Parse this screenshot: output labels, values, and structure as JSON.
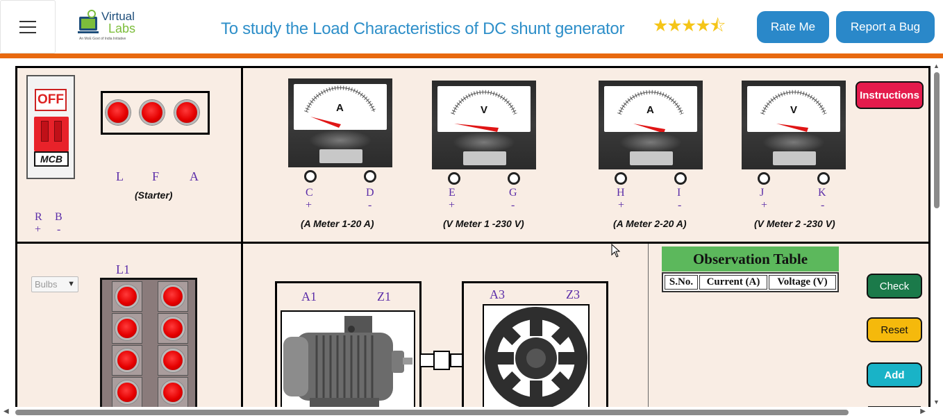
{
  "header": {
    "menu_icon": "hamburger-icon",
    "logo": {
      "line1": "Virtual",
      "line2": "Labs",
      "tagline": "An MoE Govt of India Initiative"
    },
    "title": "To study the Load Characteristics of DC shunt generator",
    "rating": {
      "value": 4.5,
      "max": 5,
      "stars": "★★★★",
      "half_star": "⯪"
    },
    "rate_button": "Rate Me",
    "bug_button": "Report a Bug"
  },
  "colors": {
    "accent_blue": "#2a88c9",
    "header_orange": "#e8690f",
    "sim_bg": "#f9ede4",
    "instructions_red": "#e41b4c",
    "check_green": "#1b7a4a",
    "reset_yellow": "#f5b90c",
    "add_teal": "#19b3c7",
    "table_green": "#5cb85c"
  },
  "mcb": {
    "state_label": "OFF",
    "name": "MCB"
  },
  "starter": {
    "terminals": [
      "L",
      "F",
      "A"
    ],
    "caption": "(Starter)"
  },
  "supply": {
    "terminals": [
      "R",
      "B"
    ],
    "polarities": [
      "+",
      "-"
    ]
  },
  "meters": [
    {
      "symbol": "A",
      "terminals": [
        "C",
        "D"
      ],
      "polarities": [
        "+",
        "-"
      ],
      "caption": "(A Meter 1-20 A)"
    },
    {
      "symbol": "V",
      "terminals": [
        "E",
        "G"
      ],
      "polarities": [
        "+",
        "-"
      ],
      "caption": "(V Meter 1 -230 V)"
    },
    {
      "symbol": "A",
      "terminals": [
        "H",
        "I"
      ],
      "polarities": [
        "+",
        "-"
      ],
      "caption": "(A Meter 2-20 A)"
    },
    {
      "symbol": "V",
      "terminals": [
        "J",
        "K"
      ],
      "polarities": [
        "+",
        "-"
      ],
      "caption": "(V Meter 2 -230 V)"
    }
  ],
  "instructions_button": "Instructions",
  "load": {
    "select_value": "Bulbs",
    "label": "L1",
    "bulb_count": 8
  },
  "motor": {
    "terminals": [
      "A1",
      "Z1"
    ]
  },
  "generator": {
    "terminals": [
      "A3",
      "Z3"
    ]
  },
  "observation": {
    "title": "Observation Table",
    "columns": [
      "S.No.",
      "Current (A)",
      "Voltage (V)"
    ]
  },
  "actions": {
    "check": "Check",
    "reset": "Reset",
    "add": "Add"
  }
}
